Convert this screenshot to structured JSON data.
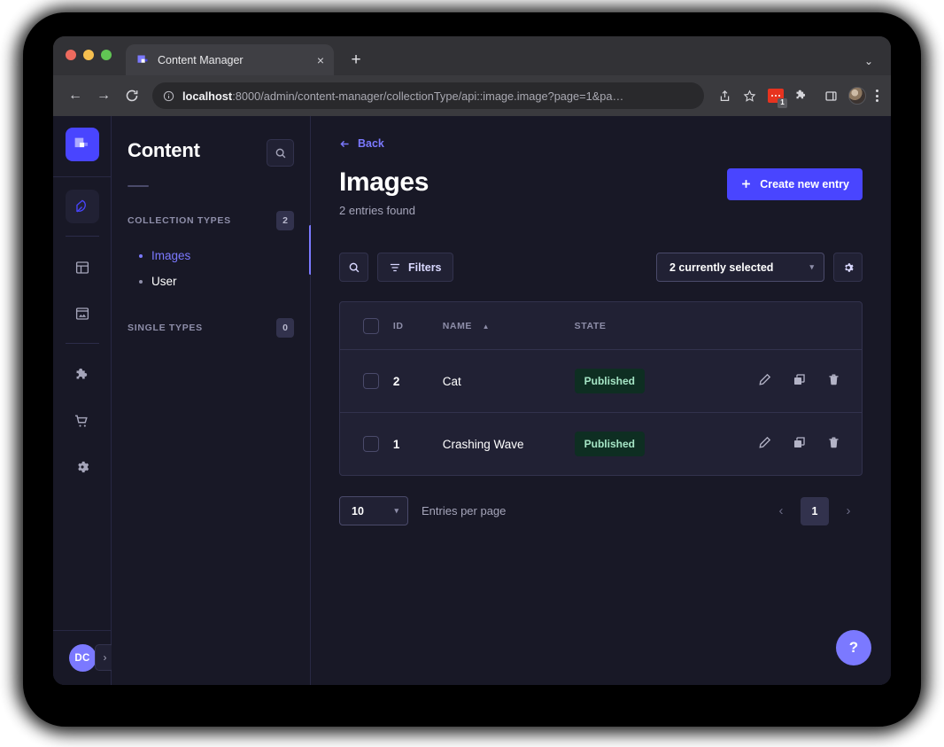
{
  "browser": {
    "tab": {
      "title": "Content Manager",
      "favicon": "strapi-logo-icon",
      "close_label": "×"
    },
    "new_tab_label": "+",
    "tab_list_caret": "⌄",
    "nav": {
      "back": "←",
      "forward": "→",
      "reload": "⟳"
    },
    "omnibox": {
      "site_info_icon": "info-circle-icon",
      "host": "localhost",
      "path": ":8000/admin/content-manager/collectionType/api::image.image?page=1&pa…",
      "full_url": "localhost:8000/admin/content-manager/collectionType/api::image.image?page=1&pa…",
      "share_icon": "share-icon",
      "bookmark_icon": "star-icon"
    },
    "extensions": {
      "badge_count": "1",
      "puzzle_icon": "puzzle-icon",
      "side_panel_icon": "side-panel-icon",
      "profile_icon": "profile-avatar",
      "menu_icon": "kebab-menu-icon"
    }
  },
  "rail": {
    "logo_label": "strapi-logo",
    "items": [
      {
        "name": "content-manager",
        "icon": "feather-pen-icon",
        "active": true
      },
      {
        "name": "content-type-builder",
        "icon": "layout-icon",
        "active": false
      },
      {
        "name": "media-library",
        "icon": "image-icon",
        "active": false
      },
      {
        "name": "plugins",
        "icon": "puzzle-icon",
        "active": false
      },
      {
        "name": "marketplace",
        "icon": "shopping-cart-icon",
        "active": false
      },
      {
        "name": "settings",
        "icon": "gear-icon",
        "active": false
      }
    ],
    "user_initials": "DC",
    "expand_icon": "›"
  },
  "sidebar": {
    "title": "Content",
    "search_icon": "search-icon",
    "sections": [
      {
        "label": "COLLECTION TYPES",
        "count": "2"
      },
      {
        "label": "SINGLE TYPES",
        "count": "0"
      }
    ],
    "collection_types": [
      {
        "label": "Images",
        "active": true
      },
      {
        "label": "User",
        "active": false
      }
    ]
  },
  "main": {
    "back_label": "Back",
    "back_icon": "arrow-left-icon",
    "title": "Images",
    "subtitle": "2 entries found",
    "create_button": {
      "label": "Create new entry",
      "icon": "plus-icon"
    },
    "toolbar": {
      "search_icon": "search-icon",
      "filters_label": "Filters",
      "filters_icon": "filter-icon",
      "selection_label": "2 currently selected",
      "selection_caret": "▾",
      "settings_icon": "gear-icon"
    },
    "table": {
      "columns": [
        "",
        "ID",
        "NAME",
        "STATE",
        ""
      ],
      "sort_column": "NAME",
      "sort_direction_icon": "▲",
      "rows": [
        {
          "id": "2",
          "name": "Cat",
          "state": "Published"
        },
        {
          "id": "1",
          "name": "Crashing Wave",
          "state": "Published"
        }
      ],
      "row_actions": [
        "edit-icon",
        "duplicate-icon",
        "delete-icon"
      ]
    },
    "pagination": {
      "per_page_value": "10",
      "per_page_caret": "▾",
      "per_page_label": "Entries per page",
      "prev_icon": "‹",
      "current_page": "1",
      "next_icon": "›"
    },
    "help_label": "?"
  },
  "colors": {
    "accent": "#4945FF",
    "accent_light": "#7B79FF",
    "app_bg": "#181826",
    "surface": "#212134",
    "border": "#32324d",
    "published_text": "#a6e6c6",
    "published_bg": "#0e2e22"
  }
}
